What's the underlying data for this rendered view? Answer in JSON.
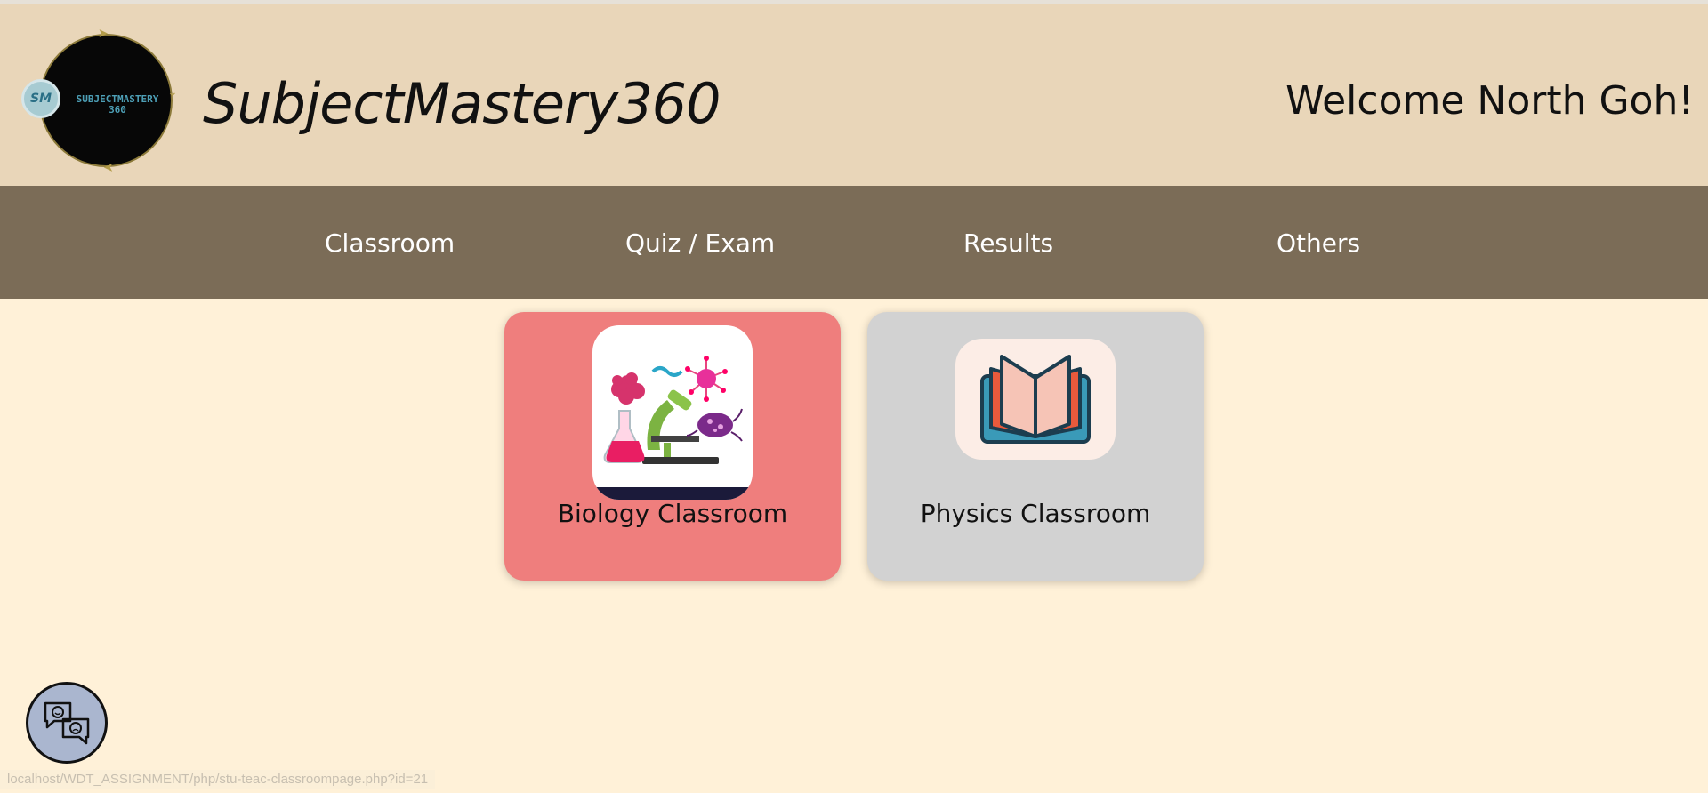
{
  "header": {
    "logo": {
      "badge": "SM",
      "text_line1": "SUBJECTMASTERY",
      "text_line2": "360"
    },
    "site_title": "SubjectMastery360",
    "welcome": "Welcome North Goh!"
  },
  "nav": {
    "items": [
      {
        "label": "Classroom"
      },
      {
        "label": "Quiz / Exam"
      },
      {
        "label": "Results"
      },
      {
        "label": "Others"
      }
    ]
  },
  "classrooms": [
    {
      "label": "Biology Classroom",
      "image": "biology-illustration",
      "bg": "#ef7e7d"
    },
    {
      "label": "Physics Classroom",
      "image": "open-book-icon",
      "bg": "#d2d2d2"
    }
  ],
  "chat": {
    "icon": "chat-faces-icon"
  },
  "status_bar": {
    "url": "localhost/WDT_ASSIGNMENT/php/stu-teac-classroompage.php?id=21"
  },
  "colors": {
    "header_bg": "#e9d6b9",
    "nav_bg": "#7b6c57",
    "page_bg": "#fff1d8",
    "biology_card": "#ef7e7d",
    "physics_card": "#d2d2d2"
  }
}
